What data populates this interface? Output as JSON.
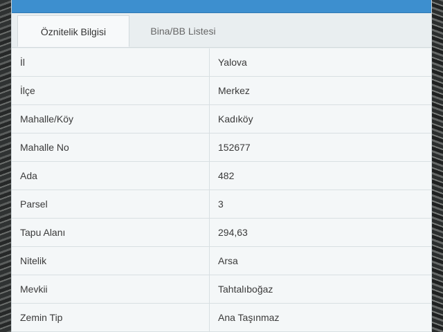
{
  "tabs": [
    {
      "label": "Öznitelik Bilgisi",
      "active": true
    },
    {
      "label": "Bina/BB Listesi",
      "active": false
    }
  ],
  "rows": [
    {
      "key": "İl",
      "value": "Yalova"
    },
    {
      "key": "İlçe",
      "value": "Merkez"
    },
    {
      "key": "Mahalle/Köy",
      "value": "Kadıköy"
    },
    {
      "key": "Mahalle No",
      "value": "152677"
    },
    {
      "key": "Ada",
      "value": "482"
    },
    {
      "key": "Parsel",
      "value": "3"
    },
    {
      "key": "Tapu Alanı",
      "value": "294,63"
    },
    {
      "key": "Nitelik",
      "value": "Arsa"
    },
    {
      "key": "Mevkii",
      "value": "Tahtalıboğaz"
    },
    {
      "key": "Zemin Tip",
      "value": "Ana Taşınmaz"
    }
  ]
}
